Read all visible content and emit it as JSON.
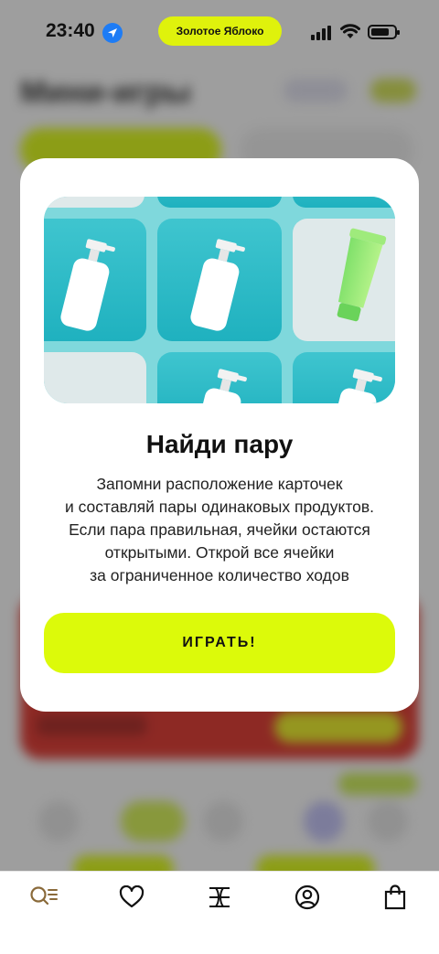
{
  "status_bar": {
    "time": "23:40",
    "island_label": "Золотое Яблоко"
  },
  "background_app": {
    "title": "Мини-игры"
  },
  "modal": {
    "title": "Найди пару",
    "description_lines": [
      "Запомни расположение карточек",
      "и составляй пары одинаковых продуктов.",
      "Если пара правильная, ячейки остаются",
      "открытыми. Открой все ячейки",
      "за ограниченное количество ходов"
    ],
    "play_button_label": "ИГРАТЬ!"
  },
  "tab_bar": {
    "items": [
      {
        "icon": "catalog-search-icon"
      },
      {
        "icon": "heart-icon"
      },
      {
        "icon": "brand-logo-icon"
      },
      {
        "icon": "profile-icon"
      },
      {
        "icon": "shopping-bag-icon"
      }
    ]
  },
  "colors": {
    "accent": "#dcfa0a",
    "tile_teal": "#2bb9c6",
    "dim_overlay": "rgba(40,40,40,0.42)"
  }
}
